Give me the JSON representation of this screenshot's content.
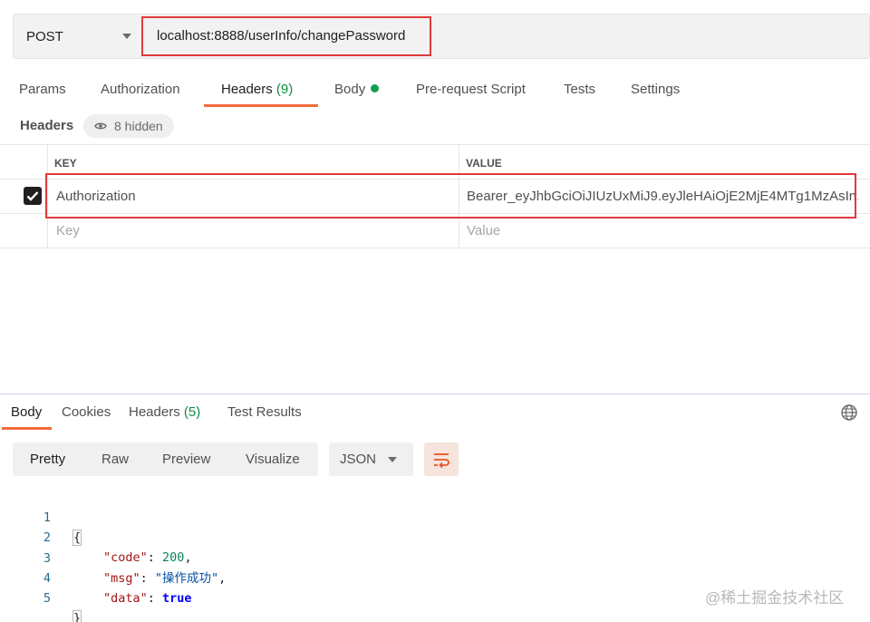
{
  "request": {
    "method": "POST",
    "url": "localhost:8888/userInfo/changePassword"
  },
  "request_tabs": [
    {
      "label": "Params"
    },
    {
      "label": "Authorization"
    },
    {
      "label": "Headers",
      "count": "(9)"
    },
    {
      "label": "Body"
    },
    {
      "label": "Pre-request Script"
    },
    {
      "label": "Tests"
    },
    {
      "label": "Settings"
    }
  ],
  "headers_section": {
    "title": "Headers",
    "hidden_label": "8 hidden"
  },
  "headers_table": {
    "columns": [
      "KEY",
      "VALUE"
    ],
    "rows": [
      {
        "checked": true,
        "key": "Authorization",
        "value": "Bearer_eyJhbGciOiJIUzUxMiJ9.eyJleHAiOjE2MjE4MTg1MzAsIn..."
      }
    ],
    "empty_row": {
      "key_placeholder": "Key",
      "value_placeholder": "Value"
    }
  },
  "response_tabs": [
    {
      "label": "Body"
    },
    {
      "label": "Cookies"
    },
    {
      "label": "Headers",
      "count": "(5)"
    },
    {
      "label": "Test Results"
    }
  ],
  "view_modes": [
    "Pretty",
    "Raw",
    "Preview",
    "Visualize"
  ],
  "format": "JSON",
  "response_body": {
    "line_numbers": [
      "1",
      "2",
      "3",
      "4",
      "5"
    ],
    "open_brace": "{",
    "close_brace": "}",
    "fields": [
      {
        "key": "\"code\"",
        "value": "200",
        "suffix": ","
      },
      {
        "key": "\"msg\"",
        "value": "\"操作成功\"",
        "suffix": ","
      },
      {
        "key": "\"data\"",
        "value": "true",
        "suffix": ""
      }
    ]
  },
  "watermark": "@稀土掘金技术社区",
  "colors": {
    "accent": "#f26b3a",
    "highlight_box": "#e03b3b",
    "count_green": "#0c8c42"
  },
  "icons": [
    "chevron-down-icon",
    "eye-icon",
    "check-icon",
    "green-dot-icon",
    "globe-icon",
    "wrap-lines-icon"
  ]
}
